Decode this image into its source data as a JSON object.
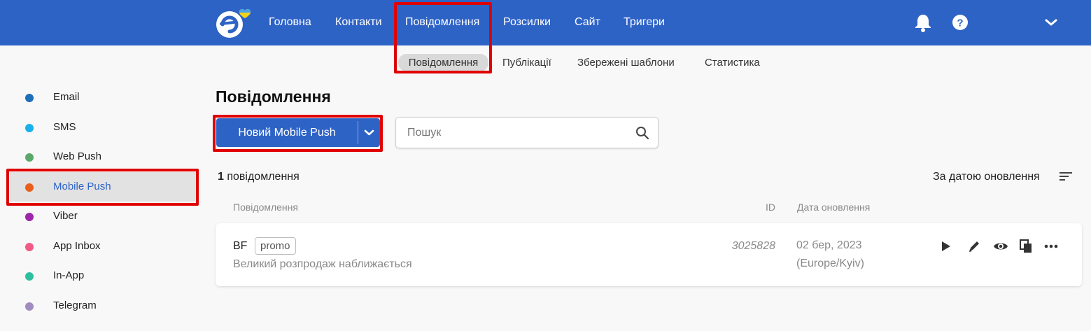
{
  "topbar": {
    "logo": "esputnik-logo",
    "nav": [
      {
        "label": "Головна",
        "icon": null
      },
      {
        "label": "Контакти",
        "icon": null
      },
      {
        "label": "Повідомлення",
        "active": true
      },
      {
        "label": "Розсилки"
      },
      {
        "label": "Сайт"
      },
      {
        "label": "Тригери"
      }
    ],
    "icons": [
      "bell-icon",
      "help-icon",
      "chevron-down-icon"
    ],
    "bg_color": "#2e63c6"
  },
  "subnav": {
    "items": [
      {
        "label": "Повідомлення",
        "active": true
      },
      {
        "label": "Публікації"
      },
      {
        "label": "Збережені шаблони"
      },
      {
        "label": "Статистика"
      }
    ]
  },
  "sidebar": {
    "items": [
      {
        "label": "Email",
        "color": "#1e6fb8"
      },
      {
        "label": "SMS",
        "color": "#1ab0ea"
      },
      {
        "label": "Web Push",
        "color": "#5aa86a"
      },
      {
        "label": "Mobile Push",
        "color": "#e8601c",
        "active": true
      },
      {
        "label": "Viber",
        "color": "#9c27a8"
      },
      {
        "label": "App Inbox",
        "color": "#ef5a86"
      },
      {
        "label": "In-App",
        "color": "#2dbfa0"
      },
      {
        "label": "Telegram",
        "color": "#a08cc0"
      }
    ]
  },
  "main": {
    "title": "Повідомлення",
    "new_button_label": "Новий Mobile Push",
    "search_placeholder": "Пошук",
    "search_value": "",
    "count_number": "1",
    "count_text": " повідомлення",
    "sort_label": "За датою оновлення",
    "columns": {
      "message": "Повідомлення",
      "id": "ID",
      "date": "Дата оновлення"
    },
    "rows": [
      {
        "name": "BF",
        "tag": "promo",
        "subtitle": "Великий розпродаж наближається",
        "id": "3025828",
        "date": "02 бер, 2023",
        "timezone": "(Europe/Kyiv)",
        "actions": [
          "play-icon",
          "edit-icon",
          "preview-icon",
          "copy-icon",
          "more-icon"
        ]
      }
    ]
  },
  "highlight_color": "#e00000"
}
